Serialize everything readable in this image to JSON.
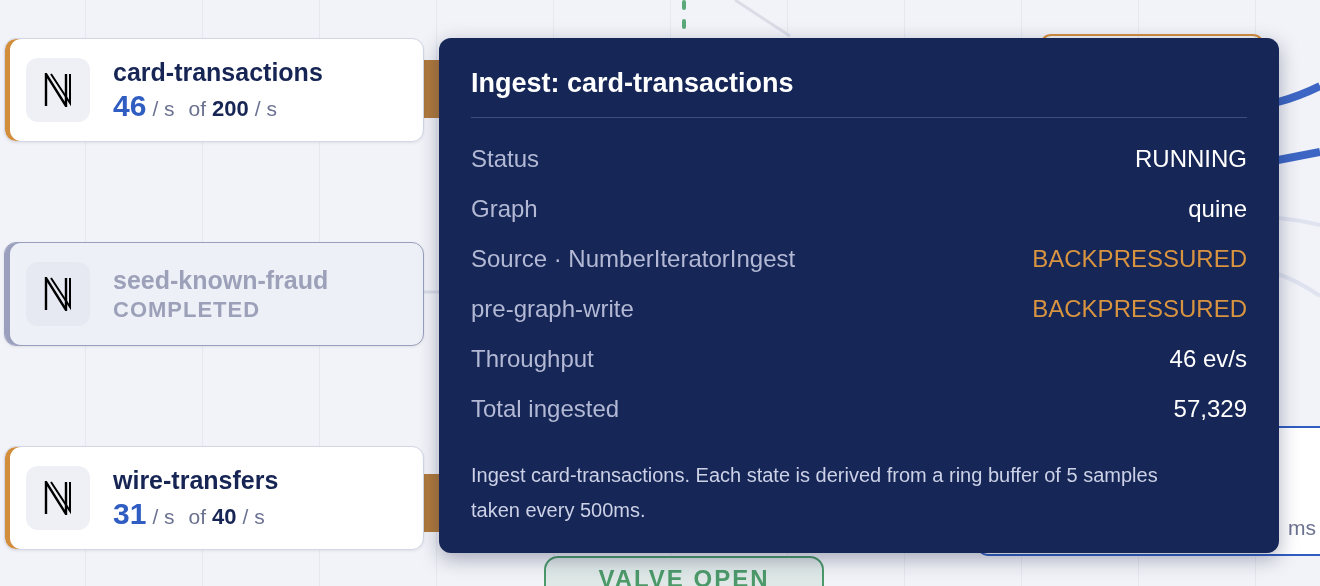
{
  "ingests": [
    {
      "kind": "running",
      "name": "card-transactions",
      "rate": "46",
      "rate_unit": "/ s",
      "of": "of",
      "max": "200",
      "max_unit": "/ s"
    },
    {
      "kind": "completed",
      "name": "seed-known-fraud",
      "status": "COMPLETED"
    },
    {
      "kind": "running",
      "name": "wire-transfers",
      "rate": "31",
      "rate_unit": "/ s",
      "of": "of",
      "max": "40",
      "max_unit": "/ s"
    }
  ],
  "tooltip": {
    "title": "Ingest: card-transactions",
    "rows": [
      {
        "label": "Status",
        "value": "RUNNING",
        "kind": "plain"
      },
      {
        "label": "Graph",
        "value": "quine",
        "kind": "plain"
      },
      {
        "label": "Source · NumberIteratorIngest",
        "value": "BACKPRESSURED",
        "kind": "warn"
      },
      {
        "label": "pre-graph-write",
        "value": "BACKPRESSURED",
        "kind": "warn"
      },
      {
        "label": "Throughput",
        "value": "46 ev/s",
        "kind": "plain"
      },
      {
        "label": "Total ingested",
        "value": "57,329",
        "kind": "plain"
      }
    ],
    "note": "Ingest card-transactions. Each state is derived from a ring buffer of 5 samples taken every 500ms."
  },
  "valve": {
    "label": "VALVE OPEN"
  },
  "right_node": {
    "text": "ms"
  }
}
